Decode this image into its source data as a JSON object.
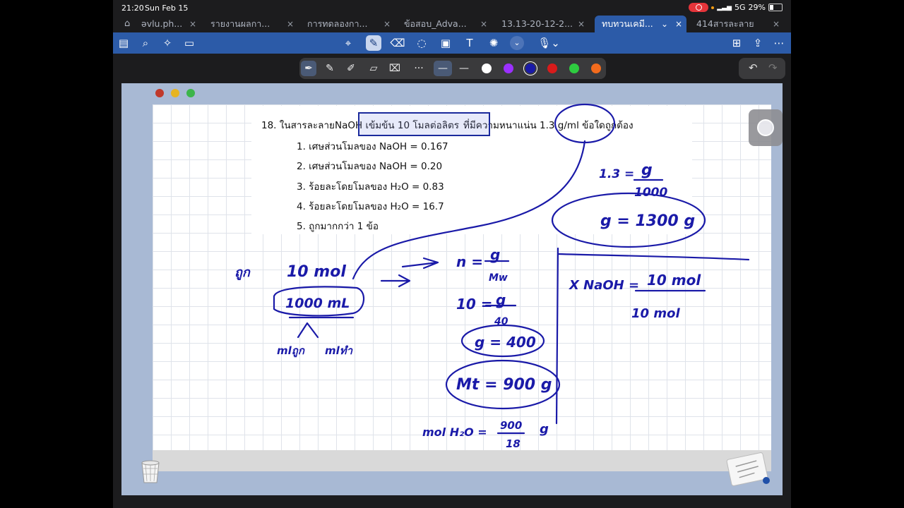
{
  "status": {
    "time": "21:20",
    "date": "Sun Feb 15",
    "signal": "5G",
    "battery": "29%"
  },
  "tabs": [
    {
      "label": "əvlu.ph...",
      "active": false
    },
    {
      "label": "รายงานผลกา...",
      "active": false
    },
    {
      "label": "การทดลองกา...",
      "active": false
    },
    {
      "label": "ข้อสอบ_Adva...",
      "active": false
    },
    {
      "label": "13.13-20-12-2...",
      "active": false
    },
    {
      "label": "ทบทวนเคมี...",
      "active": true
    },
    {
      "label": "414สารละลาย",
      "active": false
    }
  ],
  "toolbar": {
    "icons": [
      "sidebar-icon",
      "search-icon",
      "sparkle-icon",
      "document-icon",
      "lasso-icon",
      "pen-icon",
      "eraser-icon",
      "shapes-icon",
      "image-icon",
      "text-icon",
      "laser-icon",
      "chevron-down-icon",
      "microphone-icon",
      "share-icon",
      "export-icon",
      "more-icon"
    ]
  },
  "palette": {
    "colors": [
      "#ffffff",
      "#9b30ff",
      "#1a1aa8",
      "#d81b1b",
      "#2ecc40",
      "#f26b1d"
    ]
  },
  "question": {
    "stem_prefix": "18. ในสารละลาย",
    "stem_boxed": "NaOH เข้มข้น 10 โมลต่อลิตร",
    "stem_suffix": "ที่มีความหนาแน่น 1.3 g/ml ข้อใดถูกต้อง",
    "options": [
      "1. เศษส่วนโมลของ NaOH = 0.167",
      "2. เศษส่วนโมลของ NaOH = 0.20",
      "3. ร้อยละโดยโมลของ H₂O = 0.83",
      "4. ร้อยละโดยโมลของ H₂O = 16.7",
      "5. ถูกมากกว่า 1 ข้อ"
    ]
  },
  "handwriting": {
    "density": [
      "1.3 =",
      "g",
      "1000",
      "g = 1300 g"
    ],
    "left": [
      "ถูก",
      "10 mol",
      "1000 mL",
      "mlถูก",
      "mlทำ"
    ],
    "middle": [
      "n =",
      "g",
      "Mw",
      "10 =",
      "g",
      "40",
      "g = 400",
      "Mt = 900 g",
      "mol H₂O =",
      "900",
      "18",
      "g"
    ],
    "right": [
      "X NaOH =",
      "10 mol",
      "10 mol"
    ]
  }
}
